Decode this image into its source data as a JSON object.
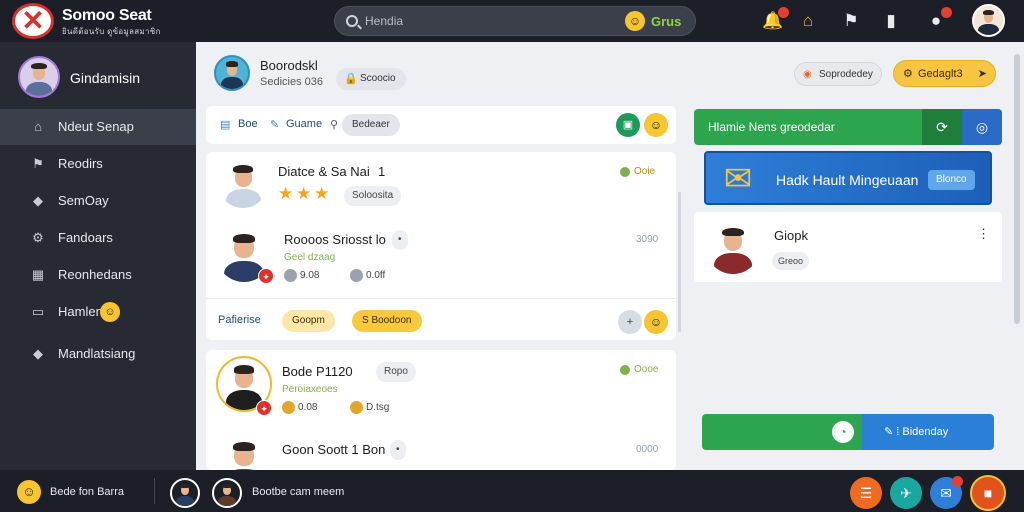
{
  "app": {
    "brand_name": "Somoo Seat",
    "brand_sub": "ยินดีต้อนรับ ดูข้อมูลสมาชิก"
  },
  "search": {
    "placeholder": "Hendia",
    "go_label": "Grus"
  },
  "sidebar": {
    "profile_name": "Gindamisin",
    "items": [
      {
        "label": "Ndeut Senap",
        "icon": "home-icon",
        "active": true
      },
      {
        "label": "Reodirs",
        "icon": "flag-icon"
      },
      {
        "label": "SemOay",
        "icon": "tag-icon"
      },
      {
        "label": "Fandoars",
        "icon": "settings-icon"
      },
      {
        "label": "Reonhedans",
        "icon": "grid-icon"
      },
      {
        "label": "Hamlen",
        "icon": "window-icon"
      },
      {
        "label": "Mandlatsiang",
        "icon": "diamond-icon"
      }
    ]
  },
  "header": {
    "title": "Boorodskl",
    "subtitle": "Sedicies 036",
    "chip_label": "Scoocio",
    "light_button": "Soprodedey",
    "primary_button": "Gedaglt3"
  },
  "toolbar": {
    "label_1": "Boe",
    "label_2": "Guame",
    "chip_label": "Bedeaer"
  },
  "posts": [
    {
      "title": "Diatce & Sa Nai",
      "extra": "1",
      "tag": "Soloosita",
      "status": "Ooie"
    },
    {
      "title": "Roooos Sriosst lo",
      "meta": "Geel dzaag",
      "time": "3090",
      "stat1": "9.08",
      "stat2": "0.0ff"
    },
    {
      "footer_label": "Pafierise",
      "footer_chip": "Goopm",
      "footer_pill": "S Boodoon"
    },
    {
      "title": "Bode P1120",
      "tag": "Ropo",
      "meta": "Peroiaxeoes",
      "status": "Oooe",
      "stat1": "0.08",
      "stat2": "D.tsg"
    },
    {
      "title": "Goon Soott 1 Bon",
      "time": "0000"
    }
  ],
  "right_panel": {
    "green_bar_label": "Hlamie Nens greodedar",
    "promo_label": "Hadk Hault Mingeuaan",
    "promo_button": "Blonco",
    "contact_name": "Giopk",
    "contact_badge": "Greoo",
    "split_right_label": "Bidenday"
  },
  "bottom_bar": {
    "label": "Bede fon Barra",
    "text": "Bootbe cam meem"
  },
  "colors": {
    "topbar": "#1c1f27",
    "sidebar": "#272a33",
    "accent_green": "#2da44e",
    "accent_blue": "#2a7fd6",
    "accent_yellow": "#f7c542",
    "danger_red": "#d8312c"
  }
}
